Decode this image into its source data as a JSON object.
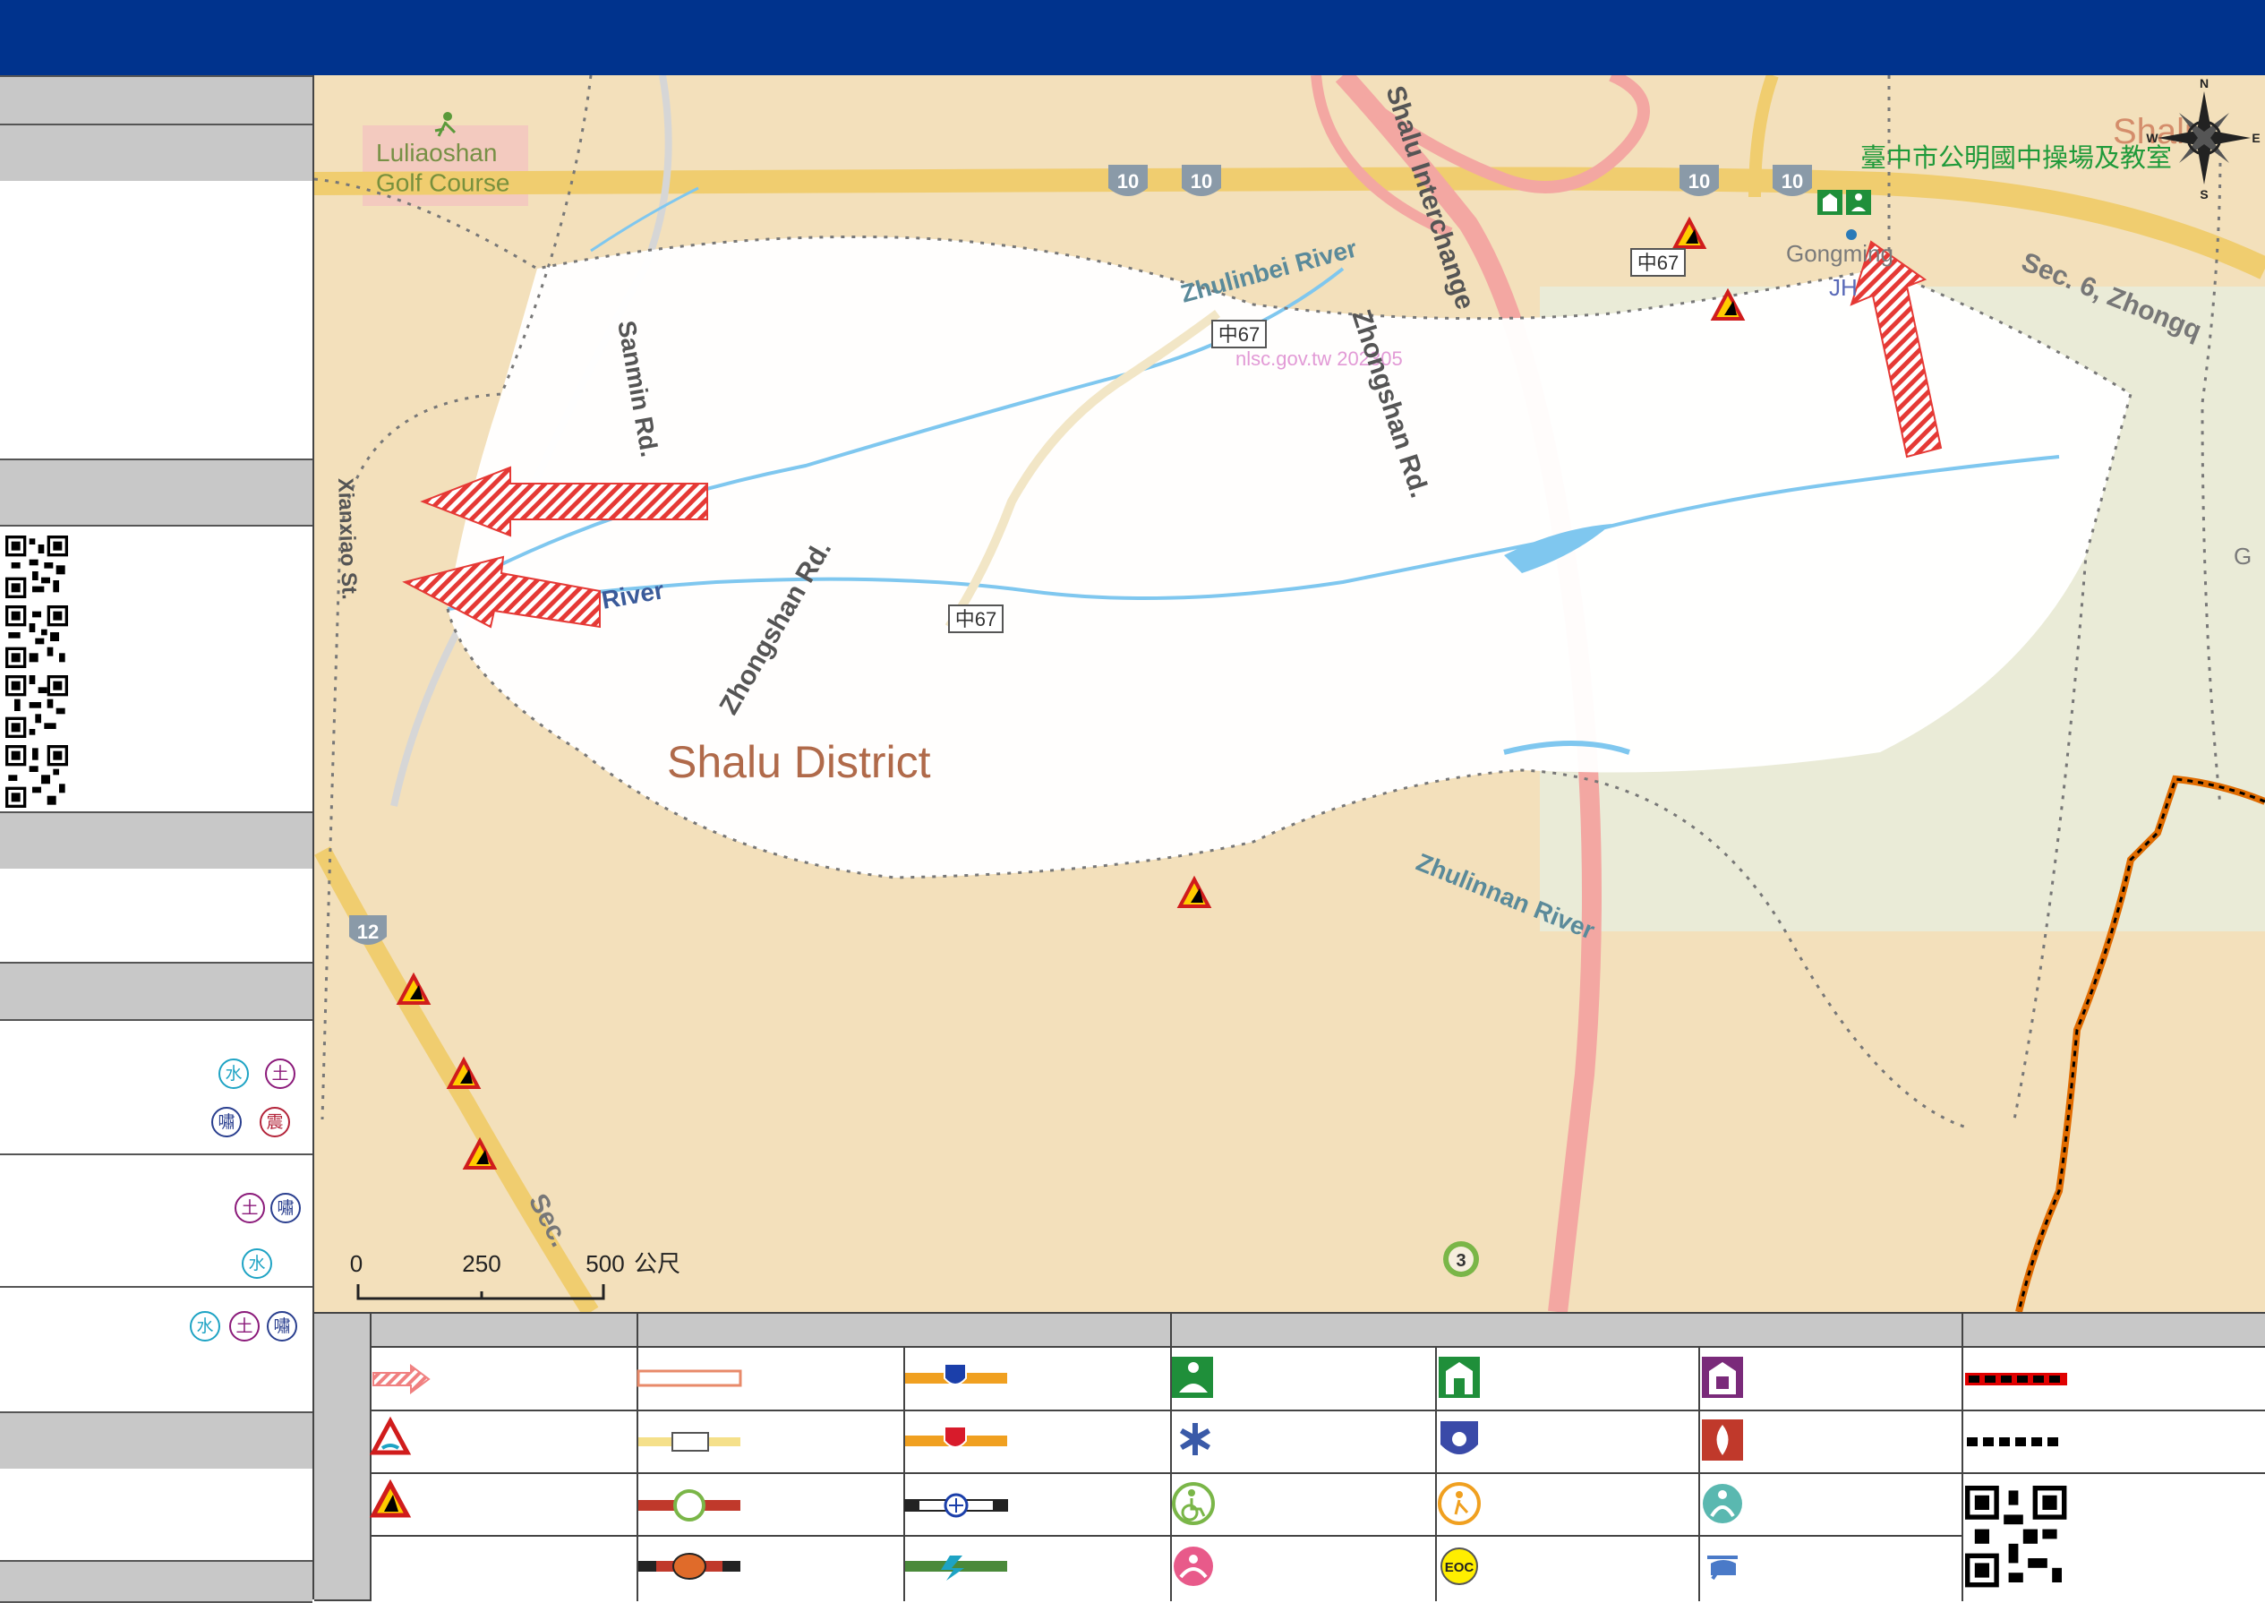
{
  "map": {
    "district_label": "Shalu District",
    "watermark": "nlsc.gov.tw 202305",
    "shelter_label": "臺中市公明國中操場及教室",
    "place_labels": {
      "golf_course": "Luliaoshan\nGolf Course",
      "gongming": "Gongming",
      "jh": "JH",
      "shalu_town": "Shalu",
      "g_edge": "G"
    },
    "road_labels": {
      "shalu_interchange": "Shalu Interchange",
      "zhongshan_rd_1": "Zhongshan Rd.",
      "zhongshan_rd_2": "Zhongshan Rd.",
      "sanmin_rd": "Sanmin Rd.",
      "xianxiao_st": "Xianxiao St.",
      "sec6_zhongq": "Sec. 6, Zhongq",
      "sec_bottom": "Sec.",
      "route_zhong67": "中67"
    },
    "river_labels": {
      "zhulinbei": "Zhulinbei River",
      "zhulinnan": "Zhulinnan River",
      "west_river": "River"
    },
    "highway_shields": [
      "10",
      "10",
      "10",
      "10",
      "12",
      "3"
    ],
    "compass_letters": [
      "N",
      "E",
      "S",
      "W"
    ],
    "scale": {
      "ticks": [
        "0",
        "250",
        "500"
      ],
      "unit": "公尺"
    }
  },
  "side_panel": {
    "hazard_badges": [
      [
        "水",
        "土"
      ],
      [
        "嘯",
        "震"
      ],
      [
        "土",
        "嘯"
      ],
      [
        "水"
      ],
      [
        "水",
        "土",
        "嘯"
      ]
    ]
  },
  "colors": {
    "header_blue": "#00338d",
    "panel_gray": "#c8c8c8",
    "evac_arrow_red": "#e53935",
    "hazard_water": "#1ea3c4",
    "hazard_landslide": "#8b1a7a",
    "hazard_tsunami": "#2a3f8f",
    "hazard_quake": "#b3243a",
    "boundary_orange": "#e06b00"
  },
  "legend": {
    "symbols": [
      "evacuation-arrow-icon",
      "flood-warning-icon",
      "landslide-warning-icon",
      "provincial-road-icon",
      "county-road-icon",
      "township-road-icon",
      "freeway-icon",
      "national-highway-icon",
      "provincial-highway-icon",
      "railway-icon",
      "hsr-icon",
      "shelter-icon",
      "evacuation-building-icon",
      "indoor-shelter-icon",
      "medical-icon",
      "police-icon",
      "fire-station-icon",
      "accessible-icon",
      "elderly-care-icon",
      "child-care-icon",
      "aid-station-icon",
      "eoc-icon",
      "helicopter-icon",
      "boundary-line-icon",
      "village-boundary-icon",
      "legend-qr-code"
    ],
    "eoc_text": "EOC"
  }
}
